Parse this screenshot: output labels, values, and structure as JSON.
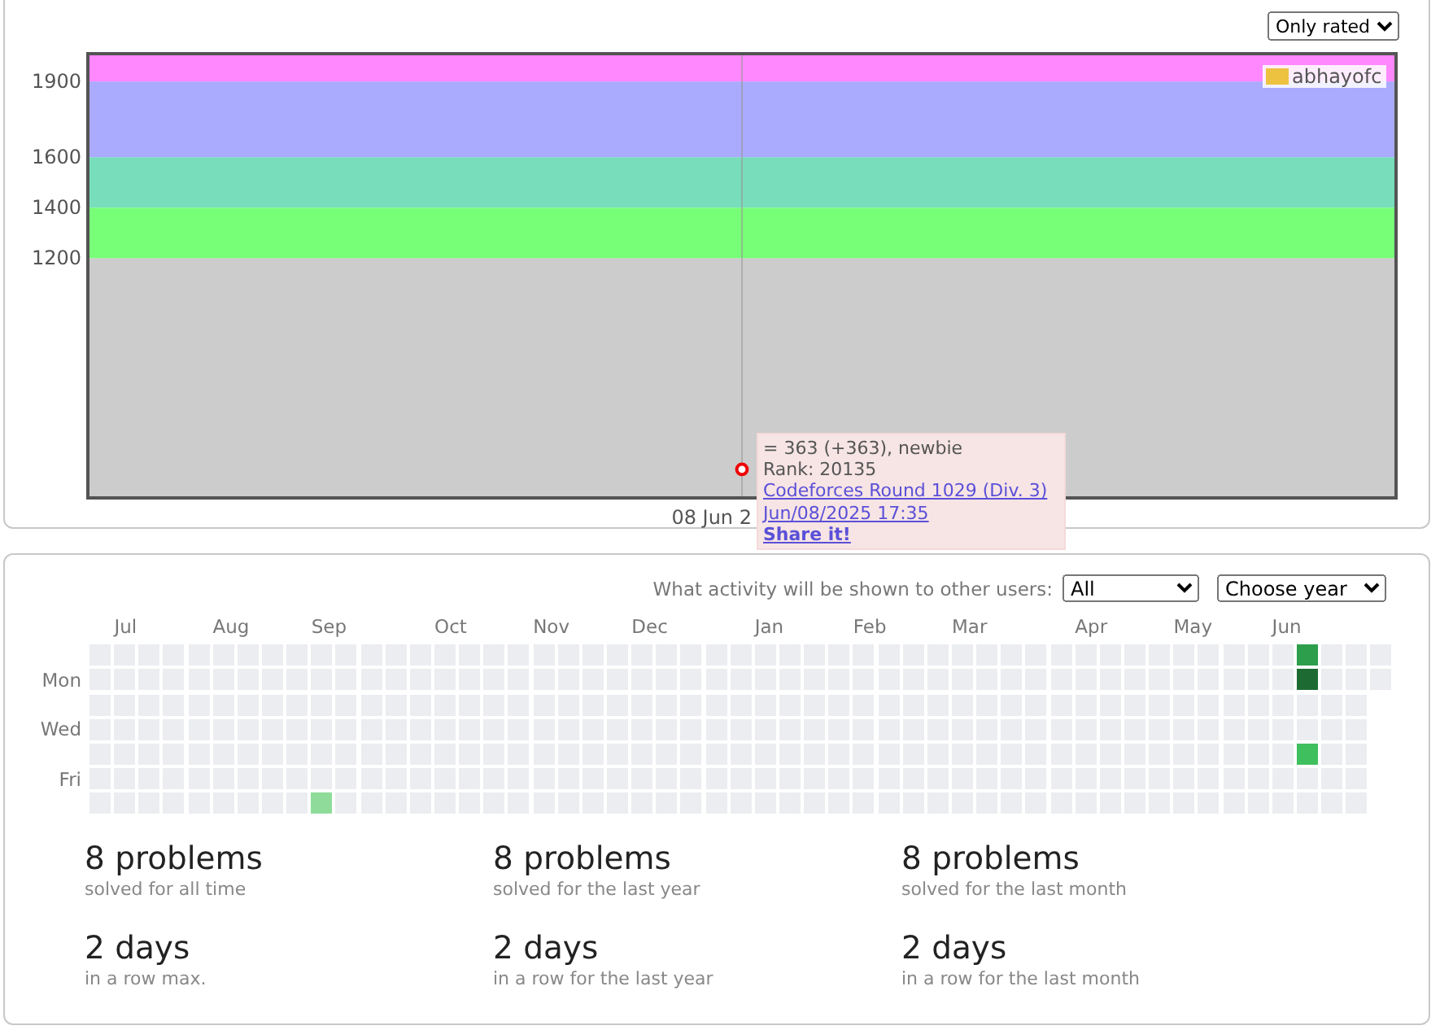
{
  "rating_panel": {
    "filter": {
      "value": "Only rated"
    },
    "y_labels": [
      "1900",
      "1600",
      "1400",
      "1200"
    ],
    "legend": {
      "name": "abhayofc",
      "color": "#edc240"
    },
    "axis_date": "08 Jun 2",
    "tooltip": {
      "summary": "= 363 (+363), newbie",
      "rank": "Rank: 20135",
      "contest": "Codeforces Round 1029 (Div. 3)",
      "date": "Jun/08/2025 17:35",
      "share": "Share it!"
    }
  },
  "activity_panel": {
    "visibility_label": "What activity will be shown to other users:",
    "visibility": {
      "value": "All"
    },
    "year": {
      "value": "Choose year"
    },
    "weekday_labels": [
      "Mon",
      "Wed",
      "Fri"
    ],
    "weeks": [
      {
        "days": [
          {
            "color": "#ebedf0"
          },
          {
            "color": "#ebedf0"
          },
          {
            "color": "#ebedf0"
          },
          {
            "color": "#ebedf0"
          },
          {
            "color": "#ebedf0"
          },
          {
            "color": "#ebedf0"
          },
          {
            "color": "#ebedf0"
          }
        ]
      },
      {
        "month": "Jul",
        "days": [
          {
            "color": "#ebedf0"
          },
          {
            "color": "#ebedf0"
          },
          {
            "color": "#ebedf0"
          },
          {
            "color": "#ebedf0"
          },
          {
            "color": "#ebedf0"
          },
          {
            "color": "#ebedf0"
          },
          {
            "color": "#ebedf0"
          }
        ]
      },
      {
        "days": [
          {
            "color": "#ebedf0"
          },
          {
            "color": "#ebedf0"
          },
          {
            "color": "#ebedf0"
          },
          {
            "color": "#ebedf0"
          },
          {
            "color": "#ebedf0"
          },
          {
            "color": "#ebedf0"
          },
          {
            "color": "#ebedf0"
          }
        ]
      },
      {
        "days": [
          {
            "color": "#ebedf0"
          },
          {
            "color": "#ebedf0"
          },
          {
            "color": "#ebedf0"
          },
          {
            "color": "#ebedf0"
          },
          {
            "color": "#ebedf0"
          },
          {
            "color": "#ebedf0"
          },
          {
            "color": "#ebedf0"
          }
        ]
      },
      {
        "days": [
          {
            "color": "#ebedf0"
          },
          {
            "color": "#ebedf0"
          },
          {
            "color": "#ebedf0"
          },
          {
            "color": "#ebedf0"
          },
          {
            "color": "#ebedf0"
          },
          {
            "color": "#ebedf0"
          },
          {
            "color": "#ebedf0"
          }
        ]
      },
      {
        "month": "Aug",
        "days": [
          {
            "color": "#ebedf0"
          },
          {
            "color": "#ebedf0"
          },
          {
            "color": "#ebedf0"
          },
          {
            "color": "#ebedf0"
          },
          {
            "color": "#ebedf0"
          },
          {
            "color": "#ebedf0"
          },
          {
            "color": "#ebedf0"
          }
        ]
      },
      {
        "days": [
          {
            "color": "#ebedf0"
          },
          {
            "color": "#ebedf0"
          },
          {
            "color": "#ebedf0"
          },
          {
            "color": "#ebedf0"
          },
          {
            "color": "#ebedf0"
          },
          {
            "color": "#ebedf0"
          },
          {
            "color": "#ebedf0"
          }
        ]
      },
      {
        "days": [
          {
            "color": "#ebedf0"
          },
          {
            "color": "#ebedf0"
          },
          {
            "color": "#ebedf0"
          },
          {
            "color": "#ebedf0"
          },
          {
            "color": "#ebedf0"
          },
          {
            "color": "#ebedf0"
          },
          {
            "color": "#ebedf0"
          }
        ]
      },
      {
        "days": [
          {
            "color": "#ebedf0"
          },
          {
            "color": "#ebedf0"
          },
          {
            "color": "#ebedf0"
          },
          {
            "color": "#ebedf0"
          },
          {
            "color": "#ebedf0"
          },
          {
            "color": "#ebedf0"
          },
          {
            "color": "#ebedf0"
          }
        ]
      },
      {
        "month": "Sep",
        "days": [
          {
            "color": "#ebedf0"
          },
          {
            "color": "#ebedf0"
          },
          {
            "color": "#ebedf0"
          },
          {
            "color": "#ebedf0"
          },
          {
            "color": "#ebedf0"
          },
          {
            "color": "#ebedf0"
          },
          {
            "color": "#8fdc9a"
          }
        ]
      },
      {
        "days": [
          {
            "color": "#ebedf0"
          },
          {
            "color": "#ebedf0"
          },
          {
            "color": "#ebedf0"
          },
          {
            "color": "#ebedf0"
          },
          {
            "color": "#ebedf0"
          },
          {
            "color": "#ebedf0"
          },
          {
            "color": "#ebedf0"
          }
        ]
      },
      {
        "days": [
          {
            "color": "#ebedf0"
          },
          {
            "color": "#ebedf0"
          },
          {
            "color": "#ebedf0"
          },
          {
            "color": "#ebedf0"
          },
          {
            "color": "#ebedf0"
          },
          {
            "color": "#ebedf0"
          },
          {
            "color": "#ebedf0"
          }
        ]
      },
      {
        "days": [
          {
            "color": "#ebedf0"
          },
          {
            "color": "#ebedf0"
          },
          {
            "color": "#ebedf0"
          },
          {
            "color": "#ebedf0"
          },
          {
            "color": "#ebedf0"
          },
          {
            "color": "#ebedf0"
          },
          {
            "color": "#ebedf0"
          }
        ]
      },
      {
        "days": [
          {
            "color": "#ebedf0"
          },
          {
            "color": "#ebedf0"
          },
          {
            "color": "#ebedf0"
          },
          {
            "color": "#ebedf0"
          },
          {
            "color": "#ebedf0"
          },
          {
            "color": "#ebedf0"
          },
          {
            "color": "#ebedf0"
          }
        ]
      },
      {
        "month": "Oct",
        "days": [
          {
            "color": "#ebedf0"
          },
          {
            "color": "#ebedf0"
          },
          {
            "color": "#ebedf0"
          },
          {
            "color": "#ebedf0"
          },
          {
            "color": "#ebedf0"
          },
          {
            "color": "#ebedf0"
          },
          {
            "color": "#ebedf0"
          }
        ]
      },
      {
        "days": [
          {
            "color": "#ebedf0"
          },
          {
            "color": "#ebedf0"
          },
          {
            "color": "#ebedf0"
          },
          {
            "color": "#ebedf0"
          },
          {
            "color": "#ebedf0"
          },
          {
            "color": "#ebedf0"
          },
          {
            "color": "#ebedf0"
          }
        ]
      },
      {
        "days": [
          {
            "color": "#ebedf0"
          },
          {
            "color": "#ebedf0"
          },
          {
            "color": "#ebedf0"
          },
          {
            "color": "#ebedf0"
          },
          {
            "color": "#ebedf0"
          },
          {
            "color": "#ebedf0"
          },
          {
            "color": "#ebedf0"
          }
        ]
      },
      {
        "days": [
          {
            "color": "#ebedf0"
          },
          {
            "color": "#ebedf0"
          },
          {
            "color": "#ebedf0"
          },
          {
            "color": "#ebedf0"
          },
          {
            "color": "#ebedf0"
          },
          {
            "color": "#ebedf0"
          },
          {
            "color": "#ebedf0"
          }
        ]
      },
      {
        "month": "Nov",
        "days": [
          {
            "color": "#ebedf0"
          },
          {
            "color": "#ebedf0"
          },
          {
            "color": "#ebedf0"
          },
          {
            "color": "#ebedf0"
          },
          {
            "color": "#ebedf0"
          },
          {
            "color": "#ebedf0"
          },
          {
            "color": "#ebedf0"
          }
        ]
      },
      {
        "days": [
          {
            "color": "#ebedf0"
          },
          {
            "color": "#ebedf0"
          },
          {
            "color": "#ebedf0"
          },
          {
            "color": "#ebedf0"
          },
          {
            "color": "#ebedf0"
          },
          {
            "color": "#ebedf0"
          },
          {
            "color": "#ebedf0"
          }
        ]
      },
      {
        "days": [
          {
            "color": "#ebedf0"
          },
          {
            "color": "#ebedf0"
          },
          {
            "color": "#ebedf0"
          },
          {
            "color": "#ebedf0"
          },
          {
            "color": "#ebedf0"
          },
          {
            "color": "#ebedf0"
          },
          {
            "color": "#ebedf0"
          }
        ]
      },
      {
        "days": [
          {
            "color": "#ebedf0"
          },
          {
            "color": "#ebedf0"
          },
          {
            "color": "#ebedf0"
          },
          {
            "color": "#ebedf0"
          },
          {
            "color": "#ebedf0"
          },
          {
            "color": "#ebedf0"
          },
          {
            "color": "#ebedf0"
          }
        ]
      },
      {
        "month": "Dec",
        "days": [
          {
            "color": "#ebedf0"
          },
          {
            "color": "#ebedf0"
          },
          {
            "color": "#ebedf0"
          },
          {
            "color": "#ebedf0"
          },
          {
            "color": "#ebedf0"
          },
          {
            "color": "#ebedf0"
          },
          {
            "color": "#ebedf0"
          }
        ]
      },
      {
        "days": [
          {
            "color": "#ebedf0"
          },
          {
            "color": "#ebedf0"
          },
          {
            "color": "#ebedf0"
          },
          {
            "color": "#ebedf0"
          },
          {
            "color": "#ebedf0"
          },
          {
            "color": "#ebedf0"
          },
          {
            "color": "#ebedf0"
          }
        ]
      },
      {
        "days": [
          {
            "color": "#ebedf0"
          },
          {
            "color": "#ebedf0"
          },
          {
            "color": "#ebedf0"
          },
          {
            "color": "#ebedf0"
          },
          {
            "color": "#ebedf0"
          },
          {
            "color": "#ebedf0"
          },
          {
            "color": "#ebedf0"
          }
        ]
      },
      {
        "days": [
          {
            "color": "#ebedf0"
          },
          {
            "color": "#ebedf0"
          },
          {
            "color": "#ebedf0"
          },
          {
            "color": "#ebedf0"
          },
          {
            "color": "#ebedf0"
          },
          {
            "color": "#ebedf0"
          },
          {
            "color": "#ebedf0"
          }
        ]
      },
      {
        "days": [
          {
            "color": "#ebedf0"
          },
          {
            "color": "#ebedf0"
          },
          {
            "color": "#ebedf0"
          },
          {
            "color": "#ebedf0"
          },
          {
            "color": "#ebedf0"
          },
          {
            "color": "#ebedf0"
          },
          {
            "color": "#ebedf0"
          }
        ]
      },
      {
        "month": "Jan",
        "days": [
          {
            "color": "#ebedf0"
          },
          {
            "color": "#ebedf0"
          },
          {
            "color": "#ebedf0"
          },
          {
            "color": "#ebedf0"
          },
          {
            "color": "#ebedf0"
          },
          {
            "color": "#ebedf0"
          },
          {
            "color": "#ebedf0"
          }
        ]
      },
      {
        "days": [
          {
            "color": "#ebedf0"
          },
          {
            "color": "#ebedf0"
          },
          {
            "color": "#ebedf0"
          },
          {
            "color": "#ebedf0"
          },
          {
            "color": "#ebedf0"
          },
          {
            "color": "#ebedf0"
          },
          {
            "color": "#ebedf0"
          }
        ]
      },
      {
        "days": [
          {
            "color": "#ebedf0"
          },
          {
            "color": "#ebedf0"
          },
          {
            "color": "#ebedf0"
          },
          {
            "color": "#ebedf0"
          },
          {
            "color": "#ebedf0"
          },
          {
            "color": "#ebedf0"
          },
          {
            "color": "#ebedf0"
          }
        ]
      },
      {
        "days": [
          {
            "color": "#ebedf0"
          },
          {
            "color": "#ebedf0"
          },
          {
            "color": "#ebedf0"
          },
          {
            "color": "#ebedf0"
          },
          {
            "color": "#ebedf0"
          },
          {
            "color": "#ebedf0"
          },
          {
            "color": "#ebedf0"
          }
        ]
      },
      {
        "month": "Feb",
        "days": [
          {
            "color": "#ebedf0"
          },
          {
            "color": "#ebedf0"
          },
          {
            "color": "#ebedf0"
          },
          {
            "color": "#ebedf0"
          },
          {
            "color": "#ebedf0"
          },
          {
            "color": "#ebedf0"
          },
          {
            "color": "#ebedf0"
          }
        ]
      },
      {
        "days": [
          {
            "color": "#ebedf0"
          },
          {
            "color": "#ebedf0"
          },
          {
            "color": "#ebedf0"
          },
          {
            "color": "#ebedf0"
          },
          {
            "color": "#ebedf0"
          },
          {
            "color": "#ebedf0"
          },
          {
            "color": "#ebedf0"
          }
        ]
      },
      {
        "days": [
          {
            "color": "#ebedf0"
          },
          {
            "color": "#ebedf0"
          },
          {
            "color": "#ebedf0"
          },
          {
            "color": "#ebedf0"
          },
          {
            "color": "#ebedf0"
          },
          {
            "color": "#ebedf0"
          },
          {
            "color": "#ebedf0"
          }
        ]
      },
      {
        "days": [
          {
            "color": "#ebedf0"
          },
          {
            "color": "#ebedf0"
          },
          {
            "color": "#ebedf0"
          },
          {
            "color": "#ebedf0"
          },
          {
            "color": "#ebedf0"
          },
          {
            "color": "#ebedf0"
          },
          {
            "color": "#ebedf0"
          }
        ]
      },
      {
        "month": "Mar",
        "days": [
          {
            "color": "#ebedf0"
          },
          {
            "color": "#ebedf0"
          },
          {
            "color": "#ebedf0"
          },
          {
            "color": "#ebedf0"
          },
          {
            "color": "#ebedf0"
          },
          {
            "color": "#ebedf0"
          },
          {
            "color": "#ebedf0"
          }
        ]
      },
      {
        "days": [
          {
            "color": "#ebedf0"
          },
          {
            "color": "#ebedf0"
          },
          {
            "color": "#ebedf0"
          },
          {
            "color": "#ebedf0"
          },
          {
            "color": "#ebedf0"
          },
          {
            "color": "#ebedf0"
          },
          {
            "color": "#ebedf0"
          }
        ]
      },
      {
        "days": [
          {
            "color": "#ebedf0"
          },
          {
            "color": "#ebedf0"
          },
          {
            "color": "#ebedf0"
          },
          {
            "color": "#ebedf0"
          },
          {
            "color": "#ebedf0"
          },
          {
            "color": "#ebedf0"
          },
          {
            "color": "#ebedf0"
          }
        ]
      },
      {
        "days": [
          {
            "color": "#ebedf0"
          },
          {
            "color": "#ebedf0"
          },
          {
            "color": "#ebedf0"
          },
          {
            "color": "#ebedf0"
          },
          {
            "color": "#ebedf0"
          },
          {
            "color": "#ebedf0"
          },
          {
            "color": "#ebedf0"
          }
        ]
      },
      {
        "days": [
          {
            "color": "#ebedf0"
          },
          {
            "color": "#ebedf0"
          },
          {
            "color": "#ebedf0"
          },
          {
            "color": "#ebedf0"
          },
          {
            "color": "#ebedf0"
          },
          {
            "color": "#ebedf0"
          },
          {
            "color": "#ebedf0"
          }
        ]
      },
      {
        "month": "Apr",
        "days": [
          {
            "color": "#ebedf0"
          },
          {
            "color": "#ebedf0"
          },
          {
            "color": "#ebedf0"
          },
          {
            "color": "#ebedf0"
          },
          {
            "color": "#ebedf0"
          },
          {
            "color": "#ebedf0"
          },
          {
            "color": "#ebedf0"
          }
        ]
      },
      {
        "days": [
          {
            "color": "#ebedf0"
          },
          {
            "color": "#ebedf0"
          },
          {
            "color": "#ebedf0"
          },
          {
            "color": "#ebedf0"
          },
          {
            "color": "#ebedf0"
          },
          {
            "color": "#ebedf0"
          },
          {
            "color": "#ebedf0"
          }
        ]
      },
      {
        "days": [
          {
            "color": "#ebedf0"
          },
          {
            "color": "#ebedf0"
          },
          {
            "color": "#ebedf0"
          },
          {
            "color": "#ebedf0"
          },
          {
            "color": "#ebedf0"
          },
          {
            "color": "#ebedf0"
          },
          {
            "color": "#ebedf0"
          }
        ]
      },
      {
        "days": [
          {
            "color": "#ebedf0"
          },
          {
            "color": "#ebedf0"
          },
          {
            "color": "#ebedf0"
          },
          {
            "color": "#ebedf0"
          },
          {
            "color": "#ebedf0"
          },
          {
            "color": "#ebedf0"
          },
          {
            "color": "#ebedf0"
          }
        ]
      },
      {
        "month": "May",
        "days": [
          {
            "color": "#ebedf0"
          },
          {
            "color": "#ebedf0"
          },
          {
            "color": "#ebedf0"
          },
          {
            "color": "#ebedf0"
          },
          {
            "color": "#ebedf0"
          },
          {
            "color": "#ebedf0"
          },
          {
            "color": "#ebedf0"
          }
        ]
      },
      {
        "days": [
          {
            "color": "#ebedf0"
          },
          {
            "color": "#ebedf0"
          },
          {
            "color": "#ebedf0"
          },
          {
            "color": "#ebedf0"
          },
          {
            "color": "#ebedf0"
          },
          {
            "color": "#ebedf0"
          },
          {
            "color": "#ebedf0"
          }
        ]
      },
      {
        "days": [
          {
            "color": "#ebedf0"
          },
          {
            "color": "#ebedf0"
          },
          {
            "color": "#ebedf0"
          },
          {
            "color": "#ebedf0"
          },
          {
            "color": "#ebedf0"
          },
          {
            "color": "#ebedf0"
          },
          {
            "color": "#ebedf0"
          }
        ]
      },
      {
        "days": [
          {
            "color": "#ebedf0"
          },
          {
            "color": "#ebedf0"
          },
          {
            "color": "#ebedf0"
          },
          {
            "color": "#ebedf0"
          },
          {
            "color": "#ebedf0"
          },
          {
            "color": "#ebedf0"
          },
          {
            "color": "#ebedf0"
          }
        ]
      },
      {
        "month": "Jun",
        "days": [
          {
            "color": "#ebedf0"
          },
          {
            "color": "#ebedf0"
          },
          {
            "color": "#ebedf0"
          },
          {
            "color": "#ebedf0"
          },
          {
            "color": "#ebedf0"
          },
          {
            "color": "#ebedf0"
          },
          {
            "color": "#ebedf0"
          }
        ]
      },
      {
        "days": [
          {
            "color": "#2d9e4b"
          },
          {
            "color": "#1d6b33"
          },
          {
            "color": "#ebedf0"
          },
          {
            "color": "#ebedf0"
          },
          {
            "color": "#3fbf5e"
          },
          {
            "color": "#ebedf0"
          },
          {
            "color": "#ebedf0"
          }
        ]
      },
      {
        "days": [
          {
            "color": "#ebedf0"
          },
          {
            "color": "#ebedf0"
          },
          {
            "color": "#ebedf0"
          },
          {
            "color": "#ebedf0"
          },
          {
            "color": "#ebedf0"
          },
          {
            "color": "#ebedf0"
          },
          {
            "color": "#ebedf0"
          }
        ]
      },
      {
        "days": [
          {
            "color": "#ebedf0"
          },
          {
            "color": "#ebedf0"
          },
          {
            "color": "#ebedf0"
          },
          {
            "color": "#ebedf0"
          },
          {
            "color": "#ebedf0"
          },
          {
            "color": "#ebedf0"
          },
          {
            "color": "#ebedf0"
          }
        ]
      },
      {
        "days": [
          {
            "color": "#ebedf0"
          },
          {
            "color": "#ebedf0"
          }
        ]
      }
    ],
    "stats": [
      {
        "value": "8 problems",
        "caption": "solved for all time"
      },
      {
        "value": "8 problems",
        "caption": "solved for the last year"
      },
      {
        "value": "8 problems",
        "caption": "solved for the last month"
      },
      {
        "value": "2 days",
        "caption": "in a row max."
      },
      {
        "value": "2 days",
        "caption": "in a row for the last year"
      },
      {
        "value": "2 days",
        "caption": "in a row for the last month"
      }
    ]
  }
}
